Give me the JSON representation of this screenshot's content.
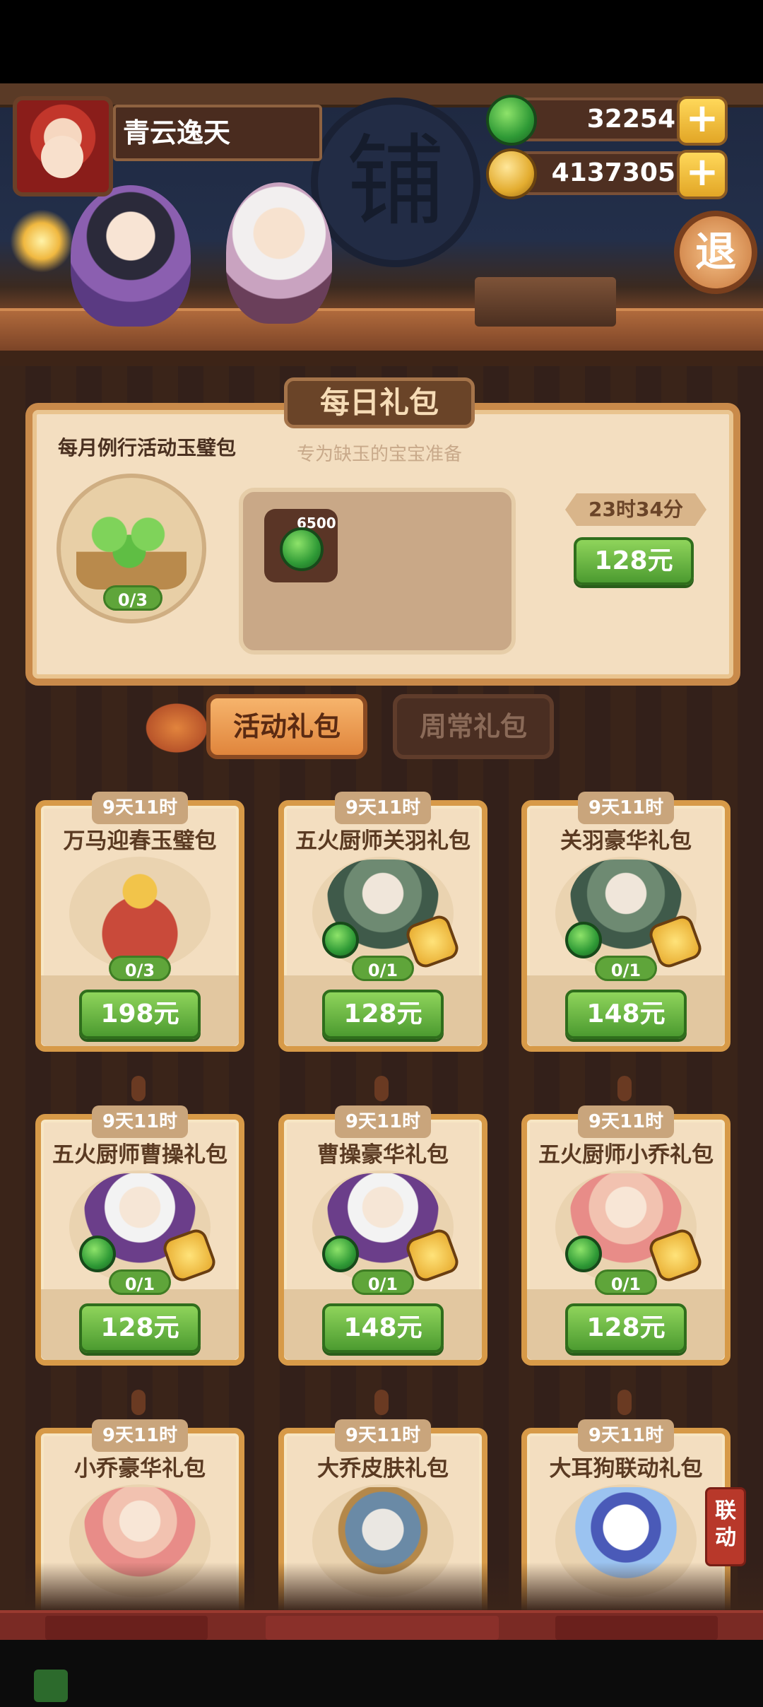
{
  "player": {
    "name": "青云逸天"
  },
  "currency": {
    "jade": "32254",
    "coins": "4137305"
  },
  "hero": {
    "sign_char": "铺",
    "exit_label": "退"
  },
  "daily": {
    "title": "每日礼包",
    "pack_name": "每月例行活动玉璧包",
    "subtitle": "专为缺玉的宝宝准备",
    "progress": "0/3",
    "item_qty": "6500",
    "timer": "23时34分",
    "price": "128元"
  },
  "tabs": [
    "活动礼包",
    "周常礼包"
  ],
  "cards": [
    {
      "timer": "9天11时",
      "title": "万马迎春玉璧包",
      "count": "0/3",
      "price": "198元"
    },
    {
      "timer": "9天11时",
      "title": "五火厨师关羽礼包",
      "count": "0/1",
      "price": "128元"
    },
    {
      "timer": "9天11时",
      "title": "关羽豪华礼包",
      "count": "0/1",
      "price": "148元"
    },
    {
      "timer": "9天11时",
      "title": "五火厨师曹操礼包",
      "count": "0/1",
      "price": "128元"
    },
    {
      "timer": "9天11时",
      "title": "曹操豪华礼包",
      "count": "0/1",
      "price": "148元"
    },
    {
      "timer": "9天11时",
      "title": "五火厨师小乔礼包",
      "count": "0/1",
      "price": "128元"
    },
    {
      "timer": "9天11时",
      "title": "小乔豪华礼包"
    },
    {
      "timer": "9天11时",
      "title": "大乔皮肤礼包"
    },
    {
      "timer": "9天11时",
      "title": "大耳狗联动礼包"
    }
  ],
  "collab_tag": "联动",
  "icons": {
    "jade": "jade-icon",
    "coin": "coin-icon",
    "plus": "plus-icon",
    "exit": "exit-icon",
    "badge": "chef-badge-icon"
  },
  "colors": {
    "accent_green": "#5fa53a",
    "frame_gold": "#d79a48",
    "tab_active": "#e0853c",
    "panel_bg": "#f3dec0"
  }
}
